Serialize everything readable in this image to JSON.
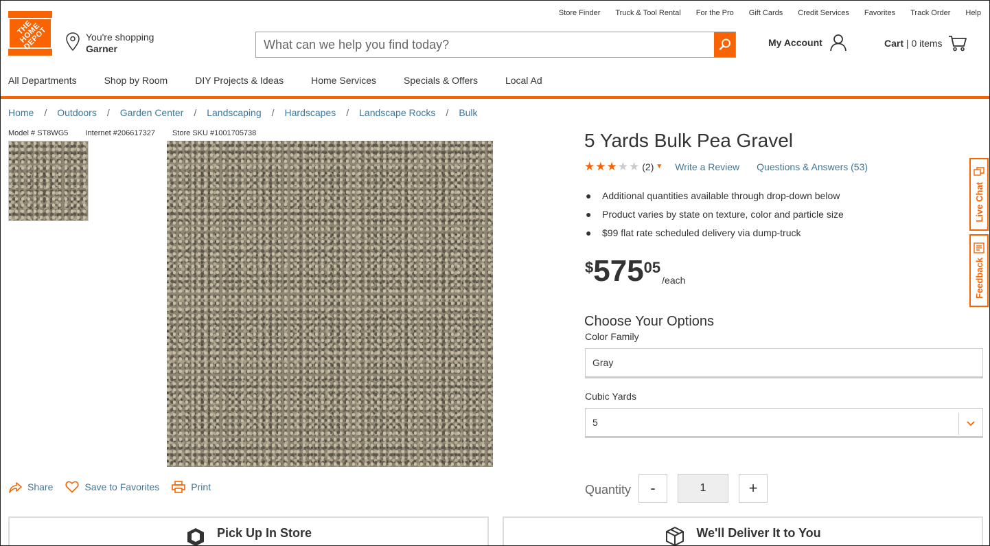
{
  "header": {
    "logo_text": "THE HOME DEPOT",
    "store_line1": "You're shopping",
    "store_name": "Garner",
    "utility_links": [
      "Store Finder",
      "Truck & Tool Rental",
      "For the Pro",
      "Gift Cards",
      "Credit Services",
      "Favorites",
      "Track Order",
      "Help"
    ],
    "search_placeholder": "What can we help you find today?",
    "account_label": "My Account",
    "cart_label": "Cart",
    "cart_count": "0 items",
    "nav": [
      "All Departments",
      "Shop by Room",
      "DIY Projects & Ideas",
      "Home Services",
      "Specials & Offers",
      "Local Ad"
    ]
  },
  "breadcrumbs": [
    "Home",
    "Outdoors",
    "Garden Center",
    "Landscaping",
    "Hardscapes",
    "Landscape Rocks",
    "Bulk"
  ],
  "breadcrumb_sep": "/",
  "ids": {
    "model": "Model # ST8WG5",
    "internet": "Internet #206617327",
    "sku": "Store SKU #1001705738"
  },
  "actions": {
    "share": "Share",
    "favorite": "Save to Favorites",
    "print": "Print"
  },
  "fulfillment": {
    "pickup": "Pick Up In Store",
    "deliver": "We'll Deliver It to You"
  },
  "product": {
    "title": "5 Yards Bulk Pea Gravel",
    "rating": 3,
    "rating_max": 5,
    "review_count": "(2)",
    "write_review": "Write a Review",
    "qa": "Questions & Answers (53)",
    "bullets": [
      "Additional quantities available through drop-down below",
      "Product varies by state on texture, color and particle size",
      "$99 flat rate scheduled delivery via dump-truck"
    ],
    "price_currency": "$",
    "price_dollars": "575",
    "price_cents": "05",
    "price_unit": "/each"
  },
  "options": {
    "title": "Choose Your Options",
    "color_label": "Color Family",
    "color_value": "Gray",
    "yards_label": "Cubic Yards",
    "yards_value": "5"
  },
  "quantity": {
    "label": "Quantity",
    "minus": "-",
    "value": "1",
    "plus": "+"
  },
  "side_tabs": {
    "live_chat": "Live Chat",
    "feedback": "Feedback"
  },
  "colors": {
    "brand_orange": "#f96302",
    "link_blue": "#3e7697"
  }
}
